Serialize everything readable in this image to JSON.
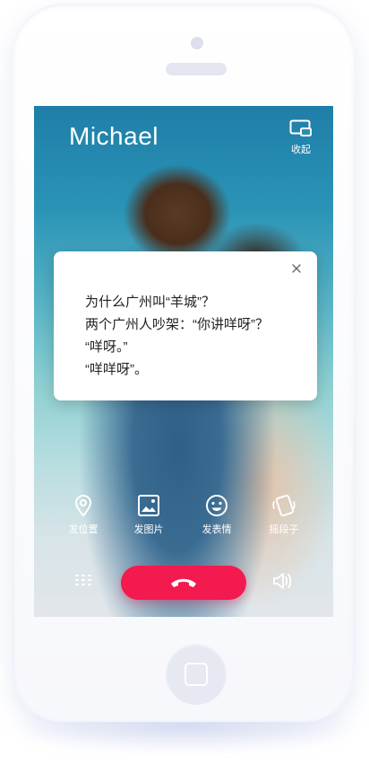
{
  "call": {
    "caller_name": "Michael",
    "collapse_label": "收起"
  },
  "dialog": {
    "lines": [
      "为什么广州叫“羊城”？",
      "两个广州人吵架：“你讲咩呀”？",
      "“咩呀。”",
      "“咩咩呀”。"
    ]
  },
  "actions": [
    {
      "label": "发位置",
      "icon": "location-pin-icon"
    },
    {
      "label": "发图片",
      "icon": "image-icon"
    },
    {
      "label": "发表情",
      "icon": "smiley-icon"
    },
    {
      "label": "摇段子",
      "icon": "shake-phone-icon"
    }
  ],
  "controls": {
    "keypad_icon": "keypad-icon",
    "hangup_icon": "hang-up-phone-icon",
    "speaker_icon": "speaker-icon"
  },
  "colors": {
    "hangup": "#f21a4f",
    "text_on_screen": "#ffffff",
    "dialog_text": "#222222"
  }
}
